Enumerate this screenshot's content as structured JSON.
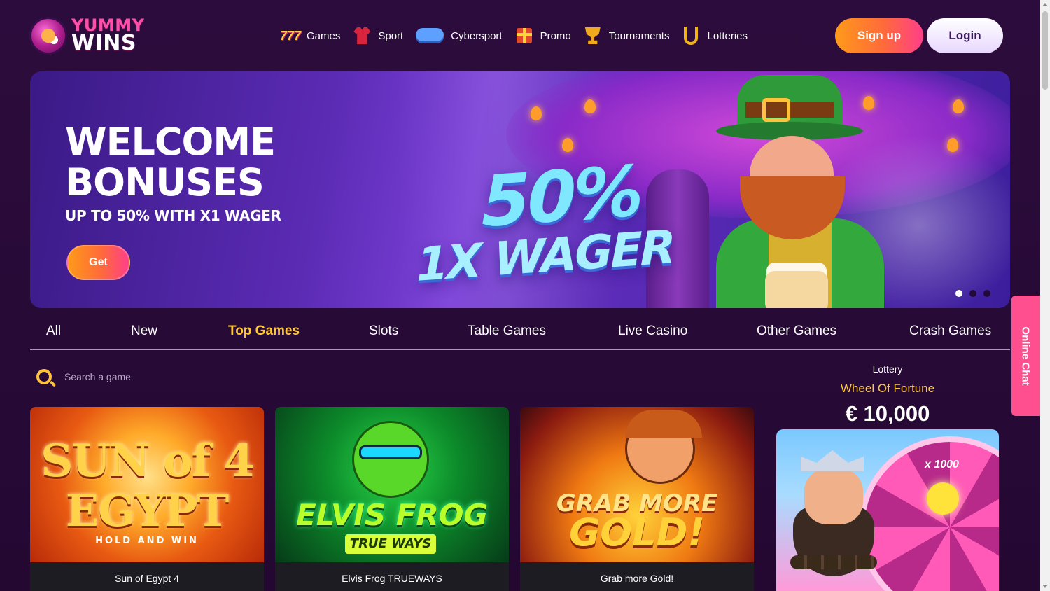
{
  "brand": {
    "line1": "YUMMY",
    "line2": "WINS"
  },
  "nav": [
    {
      "label": "Games",
      "icon": "slot-777-icon"
    },
    {
      "label": "Sport",
      "icon": "jersey-icon"
    },
    {
      "label": "Cybersport",
      "icon": "gamepad-icon"
    },
    {
      "label": "Promo",
      "icon": "gift-icon"
    },
    {
      "label": "Tournaments",
      "icon": "trophy-icon"
    },
    {
      "label": "Lotteries",
      "icon": "horseshoe-icon"
    }
  ],
  "auth": {
    "signup": "Sign up",
    "login": "Login"
  },
  "banner": {
    "title_line1": "WELCOME",
    "title_line2": "BONUSES",
    "subtitle": "UP TO 50% WITH X1 WAGER",
    "cta": "Get",
    "promo_big": "50%",
    "promo_sub": "1X WAGER",
    "slides": 3,
    "active_slide": 1
  },
  "tabs": [
    {
      "label": "All"
    },
    {
      "label": "New"
    },
    {
      "label": "Top Games",
      "active": true
    },
    {
      "label": "Slots"
    },
    {
      "label": "Table Games"
    },
    {
      "label": "Live Casino"
    },
    {
      "label": "Other Games"
    },
    {
      "label": "Crash Games"
    }
  ],
  "search": {
    "placeholder": "Search a game"
  },
  "games": [
    {
      "name": "Sun of Egypt 4",
      "art_line1": "SUN of 4",
      "art_line2": "EGYPT",
      "art_line3": "HOLD AND WIN"
    },
    {
      "name": "Elvis Frog TRUEWAYS",
      "art_line1": "ELVIS FROG",
      "art_line2": "TRUE WAYS"
    },
    {
      "name": "Grab more Gold!",
      "art_line1": "GRAB MORE",
      "art_line2": "GOLD!"
    }
  ],
  "lottery": {
    "label": "Lottery",
    "name": "Wheel Of Fortune",
    "prize": "€ 10,000",
    "multiplier": "x 1000"
  },
  "chat": {
    "label": "Online Chat"
  },
  "colors": {
    "accent": "#ffc83a",
    "cta_gradient_start": "#ff9a1a",
    "cta_gradient_end": "#ff3f8a",
    "chat": "#ff4f8f",
    "background": "#2a0a3a"
  }
}
